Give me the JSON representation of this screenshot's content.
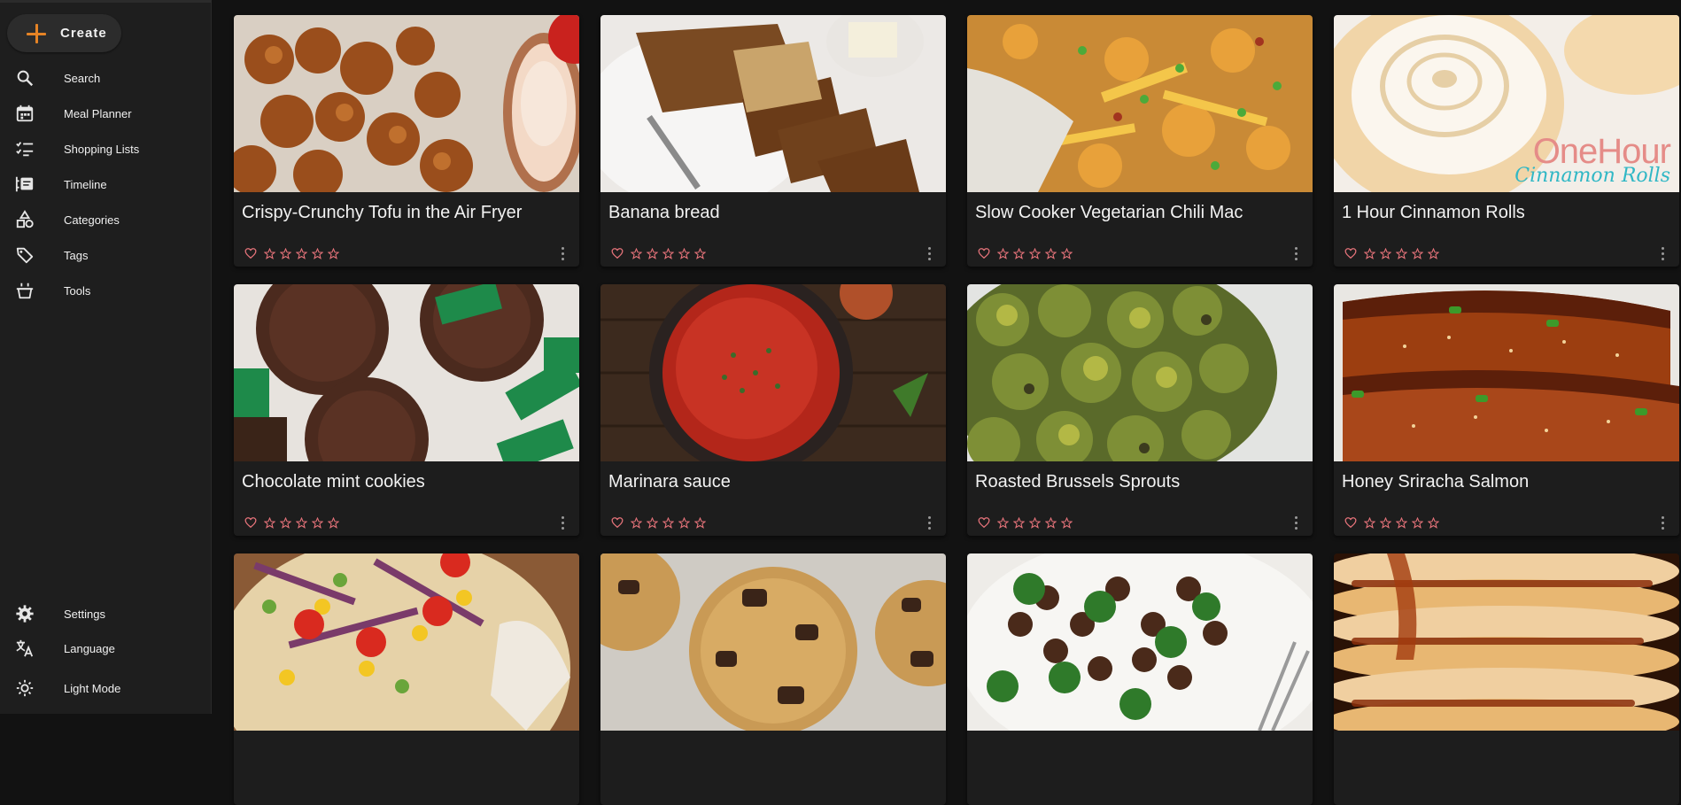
{
  "sidebar": {
    "create_label": "Create",
    "items": [
      {
        "label": "Search",
        "icon": "search-icon"
      },
      {
        "label": "Meal Planner",
        "icon": "calendar-icon"
      },
      {
        "label": "Shopping Lists",
        "icon": "checklist-icon"
      },
      {
        "label": "Timeline",
        "icon": "timeline-icon"
      },
      {
        "label": "Categories",
        "icon": "shapes-icon"
      },
      {
        "label": "Tags",
        "icon": "tags-icon"
      },
      {
        "label": "Tools",
        "icon": "pot-icon"
      }
    ],
    "bottom_items": [
      {
        "label": "Settings",
        "icon": "gear-icon"
      },
      {
        "label": "Language",
        "icon": "translate-icon"
      },
      {
        "label": "Light Mode",
        "icon": "sun-icon"
      }
    ]
  },
  "recipes": [
    {
      "title": "Crispy-Crunchy Tofu in the Air Fryer",
      "rating": 0
    },
    {
      "title": "Banana bread",
      "rating": 0
    },
    {
      "title": "Slow Cooker Vegetarian Chili Mac",
      "rating": 0
    },
    {
      "title": "1 Hour Cinnamon Rolls",
      "rating": 0,
      "image_text": [
        "OneHour",
        "Cinnamon Rolls"
      ]
    },
    {
      "title": "Chocolate mint cookies",
      "rating": 0
    },
    {
      "title": "Marinara sauce",
      "rating": 0
    },
    {
      "title": "Roasted Brussels Sprouts",
      "rating": 0
    },
    {
      "title": "Honey Sriracha Salmon",
      "rating": 0
    },
    {
      "title": "",
      "rating": 0
    },
    {
      "title": "",
      "rating": 0
    },
    {
      "title": "",
      "rating": 0
    },
    {
      "title": "",
      "rating": 0
    }
  ],
  "colors": {
    "accent": "#e58325",
    "rating": "#e5737a",
    "sidebar_bg": "#1e1e1e",
    "page_bg": "#121212",
    "card_bg": "#1d1d1d"
  }
}
